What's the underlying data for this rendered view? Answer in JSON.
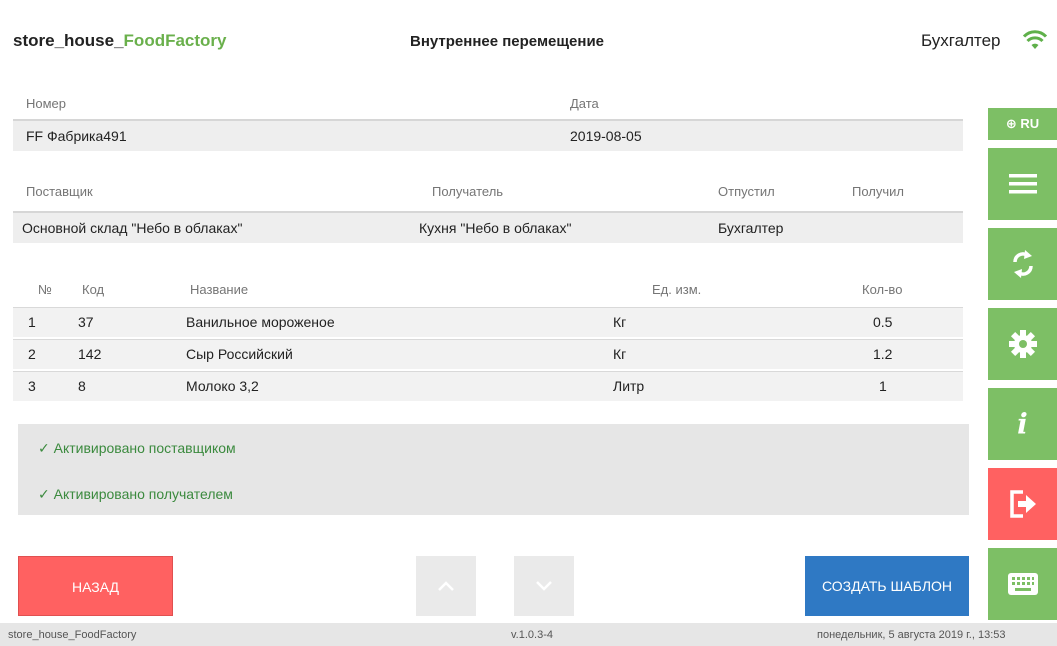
{
  "header": {
    "app_title_prefix": "store_house_",
    "app_title_accent": "FoodFactory",
    "doc_title": "Внутреннее перемещение",
    "user": "Бухгалтер"
  },
  "document": {
    "number_label": "Номер",
    "number_value": "FF Фабрика491",
    "date_label": "Дата",
    "date_value": "2019-08-05",
    "supplier_label": "Поставщик",
    "supplier_value": "Основной склад \"Небо в облаках\"",
    "receiver_label": "Получатель",
    "receiver_value": "Кухня \"Небо в облаках\"",
    "released_label": "Отпустил",
    "released_value": "Бухгалтер",
    "received_label": "Получил",
    "received_value": ""
  },
  "table": {
    "headers": [
      "№",
      "Код",
      "Название",
      "Ед. изм.",
      "Кол-во"
    ],
    "rows": [
      [
        "1",
        "37",
        "Ванильное мороженое",
        "Кг",
        "0.5"
      ],
      [
        "2",
        "142",
        "Сыр Российский",
        "Кг",
        "1.2"
      ],
      [
        "3",
        "8",
        "Молоко 3,2",
        "Литр",
        "1"
      ]
    ]
  },
  "status": {
    "supplier_activated": "✓ Активировано поставщиком",
    "receiver_activated": "✓ Активировано получателем"
  },
  "sidebar": {
    "lang": "⊕ RU",
    "icons": [
      "menu-icon",
      "sync-icon",
      "gear-icon",
      "info-icon",
      "logout-icon",
      "keyboard-icon"
    ],
    "info_glyph": "i"
  },
  "buttons": {
    "back": "НАЗАД",
    "create_template": "СОЗДАТЬ ШАБЛОН"
  },
  "footer": {
    "app": "store_house_FoodFactory",
    "version": "v.1.0.3-4",
    "datetime": "понедельник, 5 августа 2019 г., 13:53"
  },
  "colors": {
    "accent_green": "#7dbf65",
    "danger_red": "#ff6161",
    "primary_blue": "#2f79c4",
    "status_green": "#3b8a3e"
  }
}
